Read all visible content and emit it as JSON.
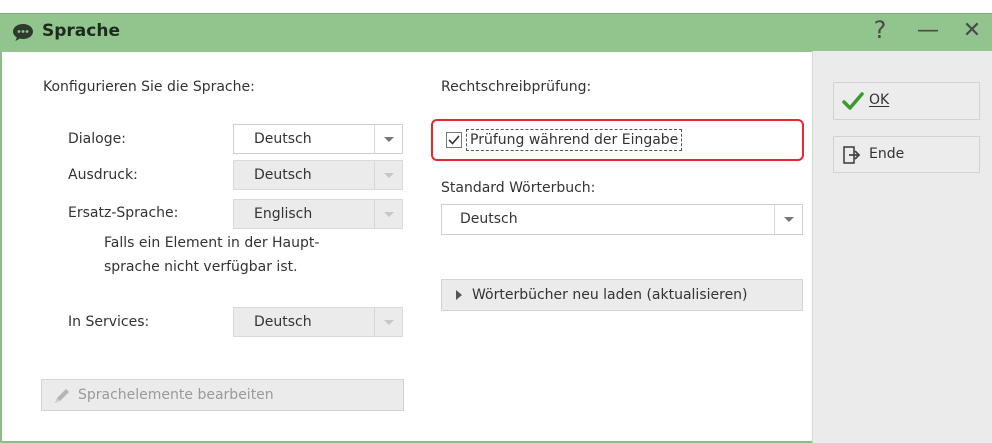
{
  "window": {
    "title": "Sprache",
    "help": "?",
    "minimize": "—",
    "close": "✕"
  },
  "language": {
    "heading": "Konfigurieren Sie die Sprache:",
    "dialoge_label": "Dialoge:",
    "dialoge_value": "Deutsch",
    "ausdruck_label": "Ausdruck:",
    "ausdruck_value": "Deutsch",
    "ersatz_label": "Ersatz-Sprache:",
    "ersatz_value": "Englisch",
    "ersatz_hint_line1": "Falls ein Element in der Haupt-",
    "ersatz_hint_line2": "sprache nicht verfügbar ist.",
    "services_label": "In Services:",
    "services_value": "Deutsch",
    "edit_button": "Sprachelemente bearbeiten"
  },
  "spellcheck": {
    "heading": "Rechtschreibprüfung:",
    "checkbox_label": "Prüfung während der Eingabe",
    "checkbox_checked": true,
    "dict_label": "Standard Wörterbuch:",
    "dict_value": "Deutsch",
    "reload_button": "Wörterbücher neu laden (aktualisieren)"
  },
  "actions": {
    "ok_label": "OK",
    "end_label": "Ende"
  },
  "colors": {
    "titlebar": "#91c58d",
    "highlight": "#e8262e",
    "ok_check": "#3a9a2e"
  }
}
